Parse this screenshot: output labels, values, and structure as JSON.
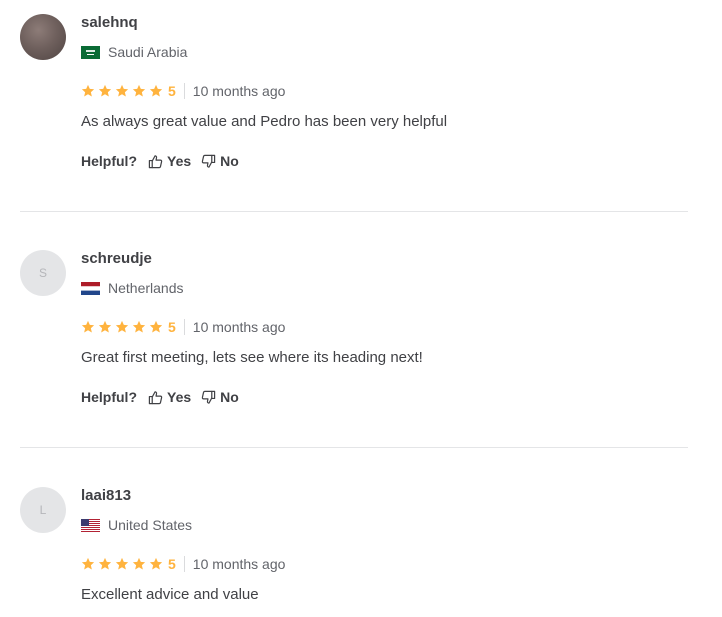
{
  "reviews": [
    {
      "username": "salehnq",
      "avatar_initial": "",
      "country": "Saudi Arabia",
      "rating": "5",
      "time": "10 months ago",
      "text": "As always great value and Pedro has been very helpful",
      "helpful_label": "Helpful?",
      "yes_label": "Yes",
      "no_label": "No"
    },
    {
      "username": "schreudje",
      "avatar_initial": "S",
      "country": "Netherlands",
      "rating": "5",
      "time": "10 months ago",
      "text": "Great first meeting, lets see where its heading next!",
      "helpful_label": "Helpful?",
      "yes_label": "Yes",
      "no_label": "No"
    },
    {
      "username": "laai813",
      "avatar_initial": "L",
      "country": "United States",
      "rating": "5",
      "time": "10 months ago",
      "text": "Excellent advice and value"
    }
  ],
  "colors": {
    "star": "#ffb33e",
    "text": "#404145",
    "muted": "#62646a",
    "divider": "#e4e5e7"
  },
  "icons": {
    "star": "star-icon",
    "thumbs_up": "thumbs-up-icon",
    "thumbs_down": "thumbs-down-icon"
  }
}
